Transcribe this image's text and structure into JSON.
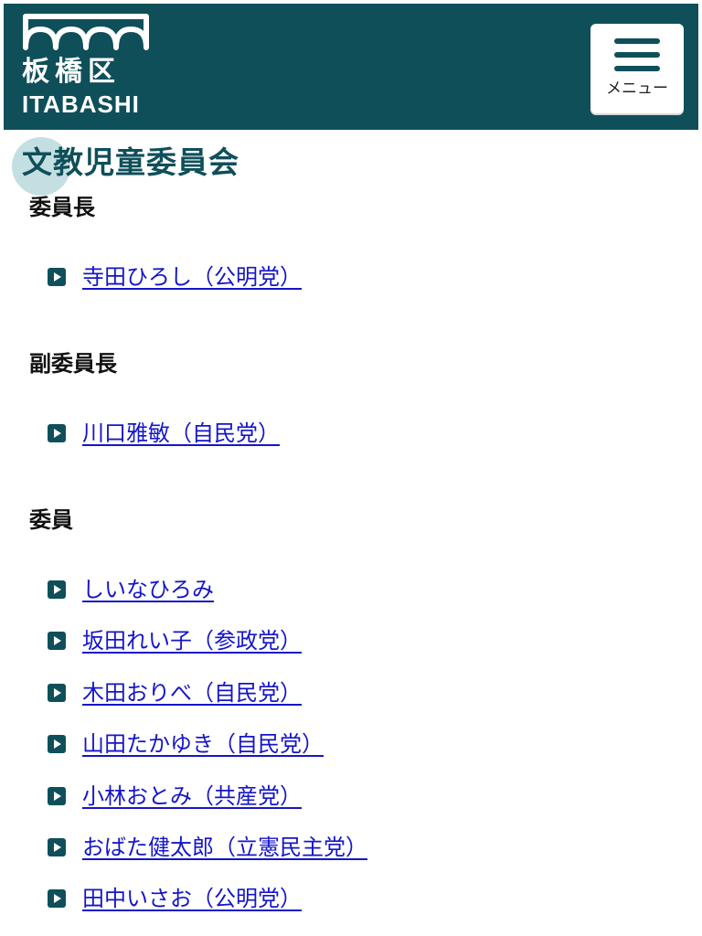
{
  "header": {
    "logo_kanji": "板橋区",
    "logo_roman": "ITABASHI",
    "menu_label": "メニュー",
    "background_color": "#0f4f5a"
  },
  "page": {
    "title": "文教児童委員会"
  },
  "sections": [
    {
      "heading": "委員長",
      "members": [
        "寺田ひろし（公明党）"
      ]
    },
    {
      "heading": "副委員長",
      "members": [
        "川口雅敏（自民党）"
      ]
    },
    {
      "heading": "委員",
      "members": [
        "しいなひろみ",
        "坂田れい子（参政党）",
        "木田おりべ（自民党）",
        "山田たかゆき（自民党）",
        "小林おとみ（共産党）",
        "おばた健太郎（立憲民主党）",
        "田中いさお（公明党）"
      ]
    }
  ],
  "icons": {
    "menu": "hamburger-icon",
    "bullet": "play-bullet-icon",
    "logo": "bridge-waves-icon"
  },
  "colors": {
    "accent": "#0f4f5a",
    "link": "#1515c9",
    "title_highlight": "#c4dfe2"
  }
}
